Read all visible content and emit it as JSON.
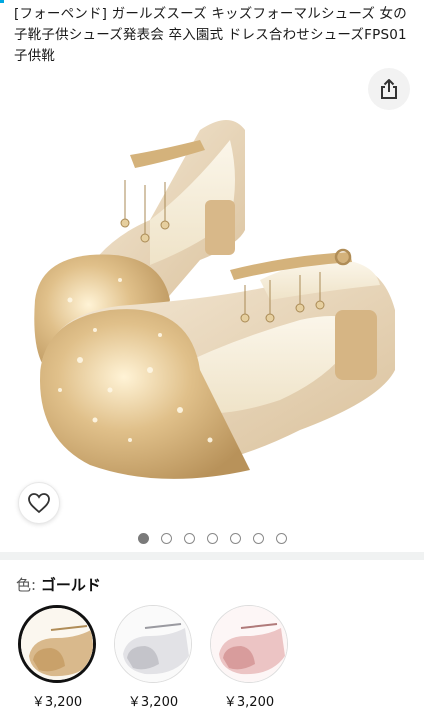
{
  "product": {
    "title": "[フォーペンド] ガールズスーズ キッズフォーマルシューズ 女の子靴子供シューズ発表会 卒入園式 ドレス合わせシューズFPS01子供靴"
  },
  "gallery": {
    "image_count": 7,
    "active_index": 0
  },
  "variation": {
    "label": "色:",
    "selected": "ゴールド",
    "options": [
      {
        "color": "#d9b98c",
        "price": "￥3,200",
        "selected": true
      },
      {
        "color": "#d8d8dc",
        "price": "￥3,200",
        "selected": false
      },
      {
        "color": "#e3b1b1",
        "price": "￥3,200",
        "selected": false
      }
    ]
  }
}
